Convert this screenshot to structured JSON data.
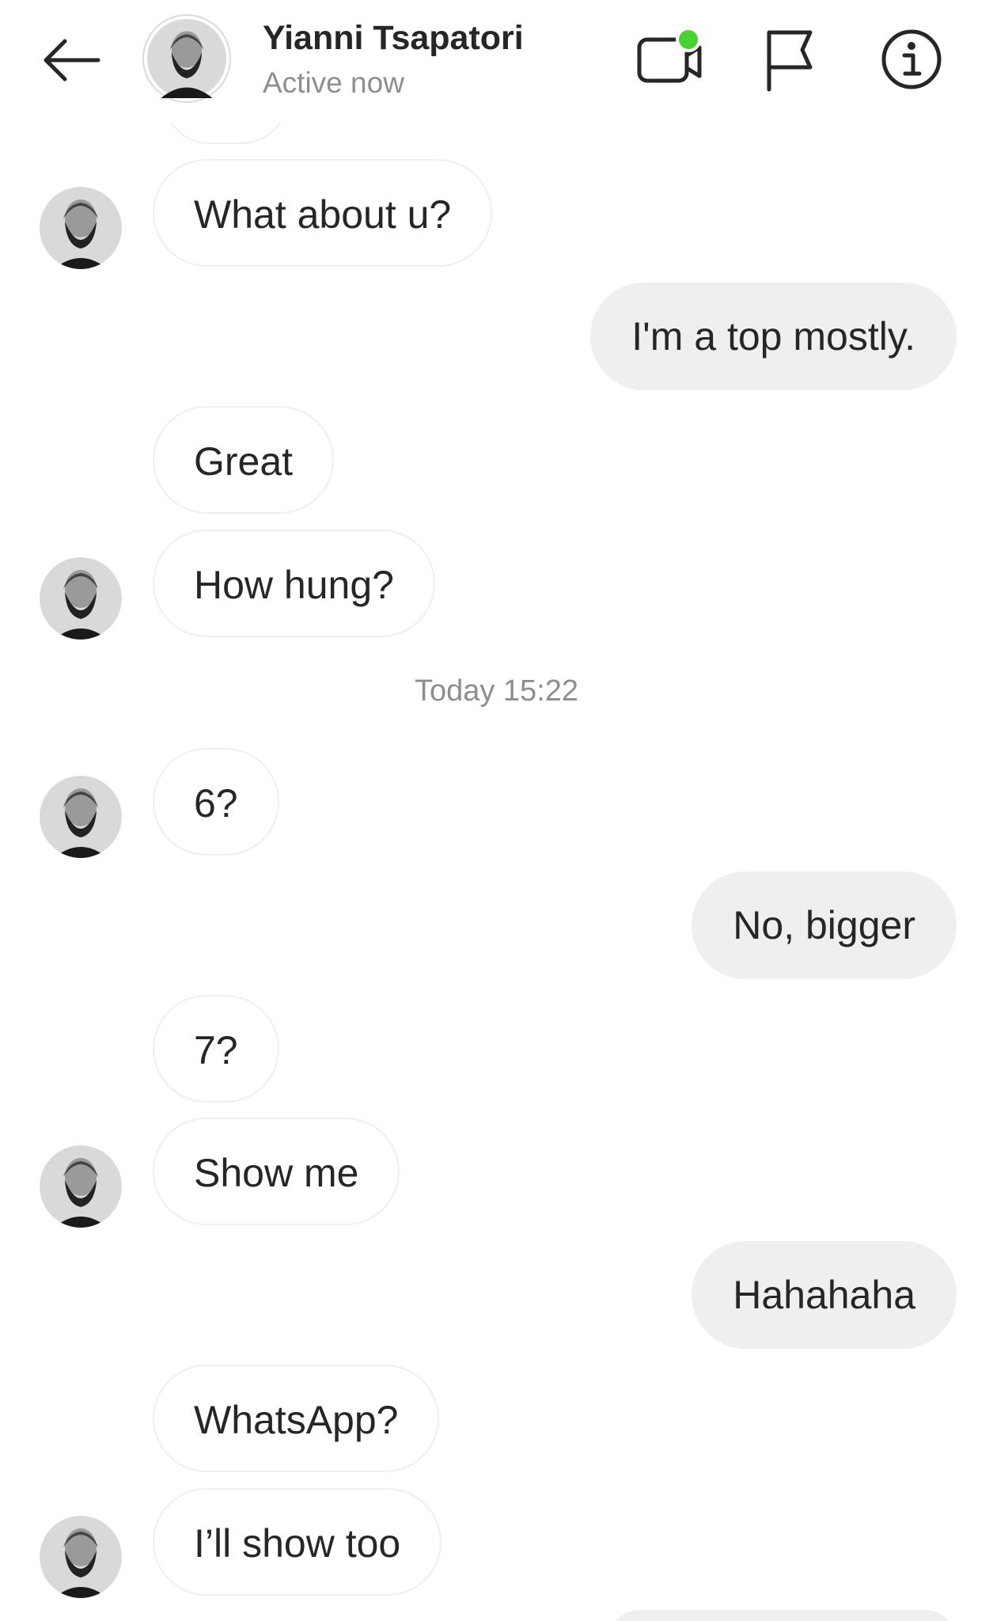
{
  "header": {
    "name": "Yianni Tsapatori",
    "status": "Active now",
    "icons": {
      "back": "back-arrow-icon",
      "video": "video-call-icon",
      "flag": "flag-icon",
      "info": "info-icon"
    },
    "online_dot_color": "#4cd134"
  },
  "thread": {
    "timestamp": "Today 15:22",
    "messages": [
      {
        "from": "them",
        "text": "What about u?"
      },
      {
        "from": "me",
        "text": "I'm a top mostly."
      },
      {
        "from": "them",
        "text": "Great"
      },
      {
        "from": "them",
        "text": "How hung?"
      },
      {
        "from": "them",
        "text": "6?"
      },
      {
        "from": "me",
        "text": "No, bigger"
      },
      {
        "from": "them",
        "text": "7?"
      },
      {
        "from": "them",
        "text": "Show me"
      },
      {
        "from": "me",
        "text": "Hahahaha"
      },
      {
        "from": "them",
        "text": "WhatsApp?"
      },
      {
        "from": "them",
        "text": "I’ll show too"
      }
    ]
  },
  "colors": {
    "incoming_border": "#efefef",
    "outgoing_bg": "#efefef",
    "muted_text": "#8e8e8e"
  }
}
